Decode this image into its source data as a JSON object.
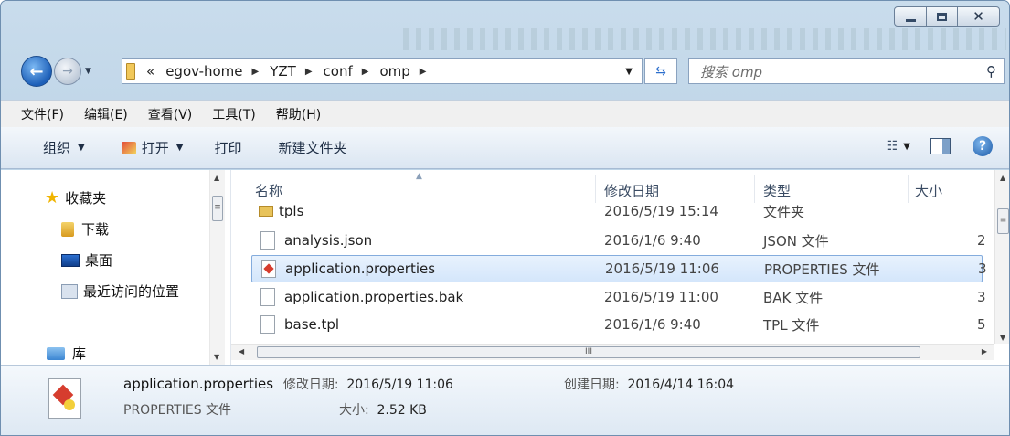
{
  "window": {
    "breadcrumb_prefix": "«",
    "breadcrumbs": [
      "egov-home",
      "YZT",
      "conf",
      "omp"
    ],
    "search_placeholder": "搜索 omp"
  },
  "menu": [
    "文件(F)",
    "编辑(E)",
    "查看(V)",
    "工具(T)",
    "帮助(H)"
  ],
  "commands": {
    "organize": "组织",
    "open": "打开",
    "print": "打印",
    "new_folder": "新建文件夹"
  },
  "nav_pane": {
    "favorites": "收藏夹",
    "downloads": "下载",
    "desktop": "桌面",
    "recent": "最近访问的位置",
    "libraries": "库"
  },
  "columns": {
    "name": "名称",
    "date": "修改日期",
    "type": "类型",
    "size": "大小"
  },
  "files": [
    {
      "name": "tpls",
      "date": "2016/5/19 15:14",
      "type": "文件夹",
      "size": "",
      "kind": "folder"
    },
    {
      "name": "analysis.json",
      "date": "2016/1/6 9:40",
      "type": "JSON 文件",
      "size": "2",
      "kind": "file"
    },
    {
      "name": "application.properties",
      "date": "2016/5/19 11:06",
      "type": "PROPERTIES 文件",
      "size": "3",
      "kind": "properties",
      "selected": true
    },
    {
      "name": "application.properties.bak",
      "date": "2016/5/19 11:00",
      "type": "BAK 文件",
      "size": "3",
      "kind": "file"
    },
    {
      "name": "base.tpl",
      "date": "2016/1/6 9:40",
      "type": "TPL 文件",
      "size": "5",
      "kind": "file"
    }
  ],
  "details": {
    "name": "application.properties",
    "modified_label": "修改日期:",
    "modified_value": "2016/5/19 11:06",
    "created_label": "创建日期:",
    "created_value": "2016/4/14 16:04",
    "type": "PROPERTIES 文件",
    "size_label": "大小:",
    "size_value": "2.52 KB"
  },
  "scroll_thumb_glyph": "≡",
  "hscroll_thumb_glyph": "III"
}
